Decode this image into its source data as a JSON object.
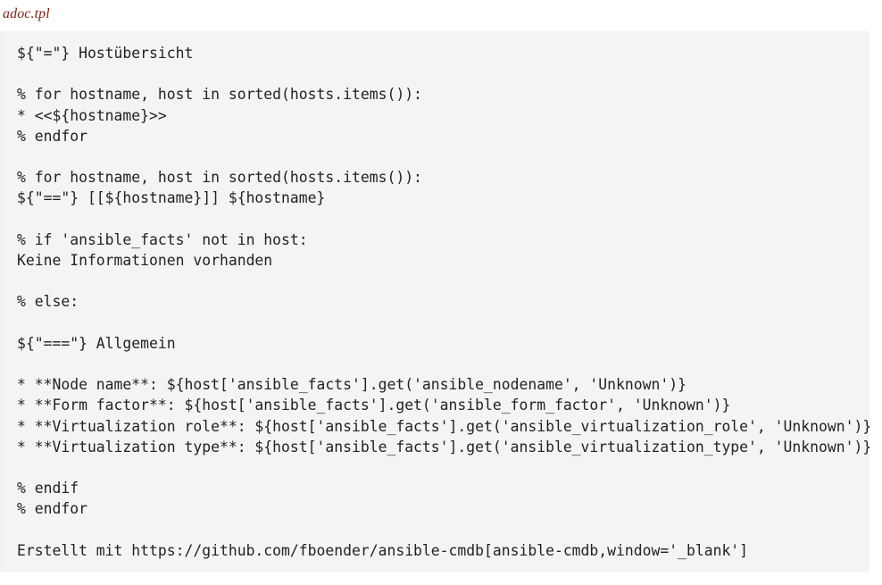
{
  "block": {
    "title": "adoc.tpl",
    "title_color": "#7a2518",
    "background_color": "#f4f4f6",
    "text_color": "#222226",
    "language": "mako-asciidoc-template"
  },
  "code": {
    "lines": [
      "${\"=\"} Hostübersicht",
      "",
      "% for hostname, host in sorted(hosts.items()):",
      "* <<${hostname}>>",
      "% endfor",
      "",
      "% for hostname, host in sorted(hosts.items()):",
      "${\"==\"} [[${hostname}]] ${hostname}",
      "",
      "% if 'ansible_facts' not in host:",
      "Keine Informationen vorhanden",
      "",
      "% else:",
      "",
      "${\"===\"} Allgemein",
      "",
      "* **Node name**: ${host['ansible_facts'].get('ansible_nodename', 'Unknown')}",
      "* **Form factor**: ${host['ansible_facts'].get('ansible_form_factor', 'Unknown')}",
      "* **Virtualization role**: ${host['ansible_facts'].get('ansible_virtualization_role', 'Unknown')}",
      "* **Virtualization type**: ${host['ansible_facts'].get('ansible_virtualization_type', 'Unknown')}",
      "",
      "% endif",
      "% endfor",
      "",
      "Erstellt mit https://github.com/fboender/ansible-cmdb[ansible-cmdb,window='_blank']"
    ]
  }
}
